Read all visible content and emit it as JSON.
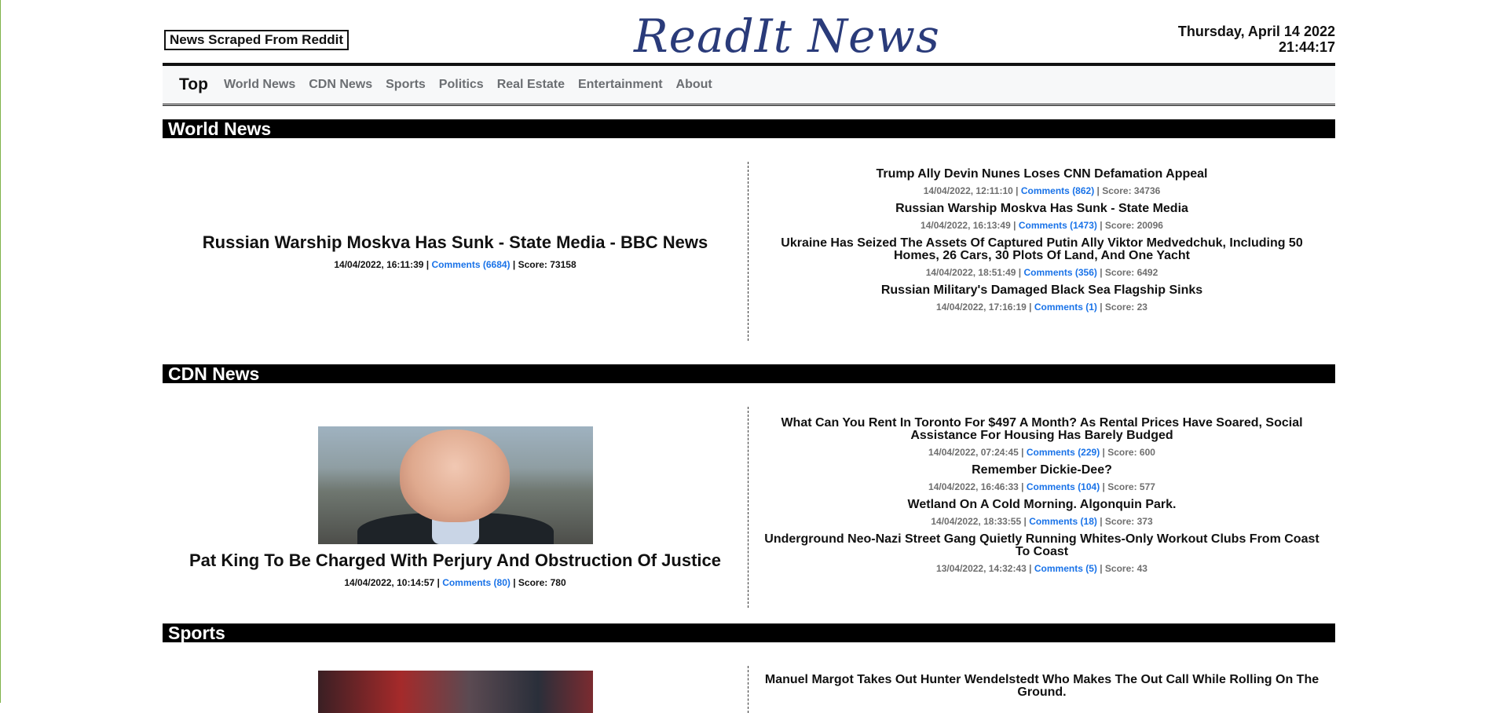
{
  "header": {
    "tagline": "News Scraped From Reddit",
    "logo": "ReadIt News",
    "date": "Thursday, April 14 2022",
    "time": "21:44:17"
  },
  "nav": {
    "brand": "Top",
    "links": [
      "World News",
      "CDN News",
      "Sports",
      "Politics",
      "Real Estate",
      "Entertainment",
      "About"
    ]
  },
  "sections": [
    {
      "name": "World News",
      "lead": {
        "title": "Russian Warship Moskva Has Sunk - State Media - BBC News",
        "date": "14/04/2022, 16:11:39",
        "comments": "Comments (6684)",
        "score": "Score: 73158"
      },
      "items": [
        {
          "title": "Trump Ally Devin Nunes Loses CNN Defamation Appeal",
          "date": "14/04/2022, 12:11:10",
          "comments": "Comments (862)",
          "score": "Score: 34736"
        },
        {
          "title": "Russian Warship Moskva Has Sunk - State Media",
          "date": "14/04/2022, 16:13:49",
          "comments": "Comments (1473)",
          "score": "Score: 20096"
        },
        {
          "title": "Ukraine Has Seized The Assets Of Captured Putin Ally Viktor Medvedchuk, Including 50 Homes, 26 Cars, 30 Plots Of Land, And One Yacht",
          "date": "14/04/2022, 18:51:49",
          "comments": "Comments (356)",
          "score": "Score: 6492"
        },
        {
          "title": "Russian Military's Damaged Black Sea Flagship Sinks",
          "date": "14/04/2022, 17:16:19",
          "comments": "Comments (1)",
          "score": "Score: 23"
        }
      ]
    },
    {
      "name": "CDN News",
      "lead": {
        "title": "Pat King To Be Charged With Perjury And Obstruction Of Justice",
        "date": "14/04/2022, 10:14:57",
        "comments": "Comments (80)",
        "score": "Score: 780"
      },
      "items": [
        {
          "title": "What Can You Rent In Toronto For $497 A Month? As Rental Prices Have Soared, Social Assistance For Housing Has Barely Budged",
          "date": "14/04/2022, 07:24:45",
          "comments": "Comments (229)",
          "score": "Score: 600"
        },
        {
          "title": "Remember Dickie-Dee?",
          "date": "14/04/2022, 16:46:33",
          "comments": "Comments (104)",
          "score": "Score: 577"
        },
        {
          "title": "Wetland On A Cold Morning. Algonquin Park.",
          "date": "14/04/2022, 18:33:55",
          "comments": "Comments (18)",
          "score": "Score: 373"
        },
        {
          "title": "Underground Neo-Nazi Street Gang Quietly Running Whites-Only Workout Clubs From Coast To Coast",
          "date": "13/04/2022, 14:32:43",
          "comments": "Comments (5)",
          "score": "Score: 43"
        }
      ]
    },
    {
      "name": "Sports",
      "items": [
        {
          "title": "Manuel Margot Takes Out Hunter Wendelstedt Who Makes The Out Call While Rolling On The Ground."
        }
      ]
    }
  ],
  "separator": "|"
}
